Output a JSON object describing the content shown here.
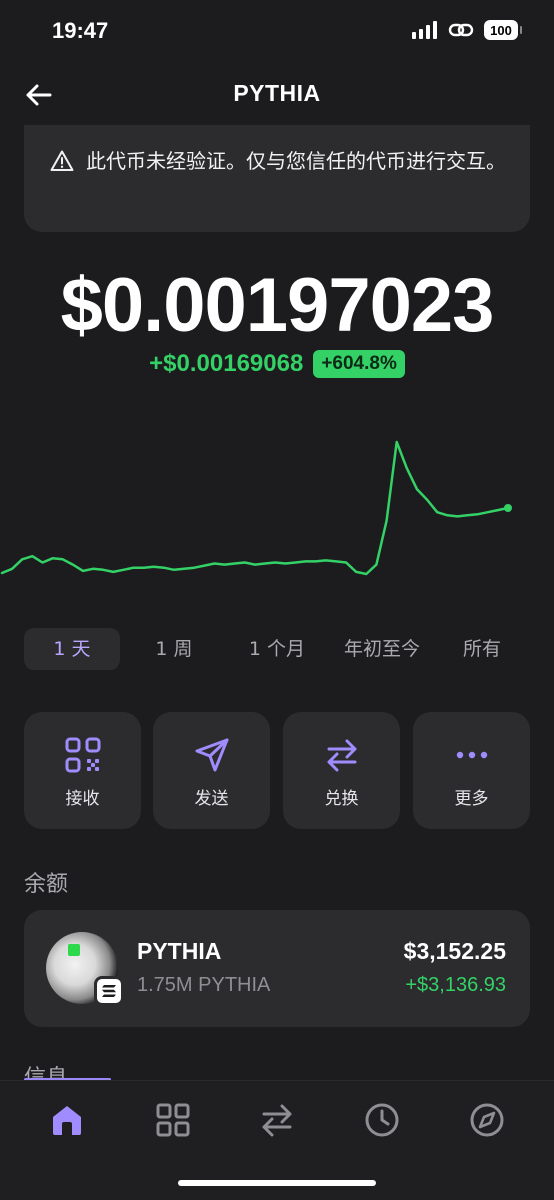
{
  "status_bar": {
    "time": "19:47",
    "battery": "100"
  },
  "header": {
    "title": "PYTHIA"
  },
  "warning": {
    "text": "此代币未经验证。仅与您信任的代币进行交互。"
  },
  "price": {
    "value": "$0.00197023",
    "change_abs": "+$0.00169068",
    "change_pct": "+604.8%"
  },
  "chart_data": {
    "type": "line",
    "x": [
      0,
      1,
      2,
      3,
      4,
      5,
      6,
      7,
      8,
      9,
      10,
      11,
      12,
      13,
      14,
      15,
      16,
      17,
      18,
      19,
      20,
      21,
      22,
      23,
      24,
      25,
      26,
      27,
      28,
      29,
      30,
      31,
      32,
      33,
      34,
      35,
      36,
      37,
      38,
      39,
      40,
      41,
      42,
      43,
      44,
      45,
      46,
      47,
      48,
      49,
      50
    ],
    "values": [
      1.0,
      1.4,
      2.3,
      2.6,
      2.0,
      2.4,
      2.3,
      1.8,
      1.2,
      1.4,
      1.3,
      1.1,
      1.3,
      1.5,
      1.5,
      1.6,
      1.5,
      1.3,
      1.4,
      1.5,
      1.7,
      1.9,
      1.8,
      1.9,
      2.0,
      1.8,
      1.9,
      2.0,
      1.9,
      2.0,
      2.1,
      2.1,
      2.2,
      2.1,
      2.0,
      1.1,
      0.9,
      1.8,
      6.0,
      13.5,
      11.0,
      9.0,
      8.0,
      6.8,
      6.5,
      6.4,
      6.5,
      6.6,
      6.8,
      7.0,
      7.2
    ],
    "line_color": "#34d167",
    "grid": false
  },
  "range_tabs": [
    {
      "label": "1 天",
      "active": true
    },
    {
      "label": "1 周",
      "active": false
    },
    {
      "label": "1 个月",
      "active": false
    },
    {
      "label": "年初至今",
      "active": false
    },
    {
      "label": "所有",
      "active": false
    }
  ],
  "actions": [
    {
      "label": "接收",
      "icon": "qr-code-icon"
    },
    {
      "label": "发送",
      "icon": "send-icon"
    },
    {
      "label": "兑换",
      "icon": "swap-icon"
    },
    {
      "label": "更多",
      "icon": "more-icon"
    }
  ],
  "balance": {
    "section_title": "余额",
    "token_name": "PYTHIA",
    "token_amount": "1.75M PYTHIA",
    "usd_value": "$3,152.25",
    "usd_change": "+$3,136.93"
  },
  "info": {
    "section_title": "信息"
  },
  "tab_bar": [
    {
      "icon": "home-icon",
      "active": true
    },
    {
      "icon": "apps-grid-icon",
      "active": false
    },
    {
      "icon": "swap-icon",
      "active": false
    },
    {
      "icon": "clock-icon",
      "active": false
    },
    {
      "icon": "compass-icon",
      "active": false
    }
  ],
  "colors": {
    "accent": "#9b87f5",
    "positive": "#34d167",
    "background": "#1c1c1e",
    "card": "#2c2c2e"
  }
}
